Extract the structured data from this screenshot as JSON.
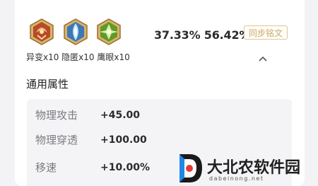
{
  "runes": [
    {
      "icon": "rune-yibian-icon",
      "color": "#c8582c"
    },
    {
      "icon": "rune-yinni-icon",
      "color": "#4aa0d8"
    },
    {
      "icon": "rune-yingyan-icon",
      "color": "#8cc63f"
    }
  ],
  "rune_counts": "异变x10 隐匿x10 鹰眼x10",
  "rates": "37.33% 56.42%",
  "sync_button": "同步铭文",
  "section_title": "通用属性",
  "attributes": [
    {
      "name": "物理攻击",
      "value": "+45.00"
    },
    {
      "name": "物理穿透",
      "value": "+100.00"
    },
    {
      "name": "移速",
      "value": "+10.00%"
    }
  ],
  "watermark": {
    "title": "大北农软件园",
    "url": "dabeinong.net"
  },
  "colors": {
    "accent_gold": "#c9a96a",
    "background": "#f3f3f5"
  }
}
